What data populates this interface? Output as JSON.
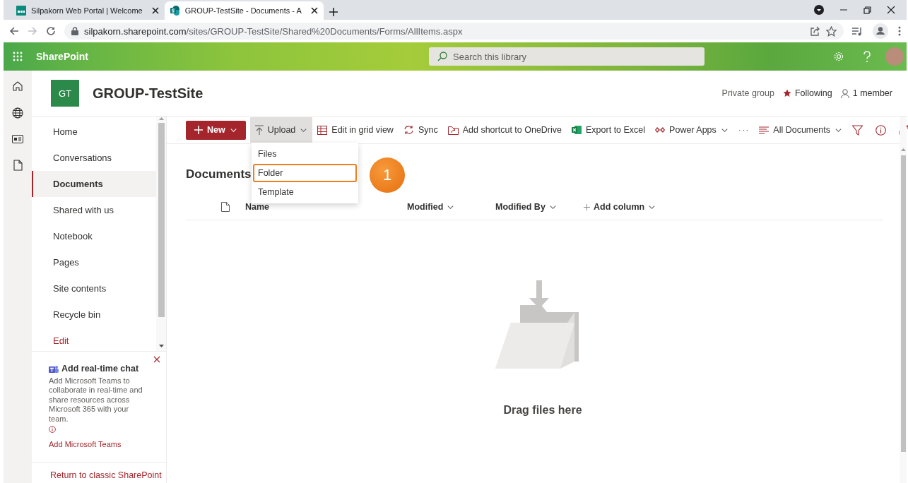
{
  "browser": {
    "tabs": [
      {
        "title": "Silpakorn Web Portal | Welcome",
        "selected": false
      },
      {
        "title": "GROUP-TestSite - Documents - A",
        "selected": true
      }
    ],
    "url_host": "silpakorn.sharepoint.com",
    "url_path": "/sites/GROUP-TestSite/Shared%20Documents/Forms/AllItems.aspx"
  },
  "suite_bar": {
    "app_name": "SharePoint",
    "search": {
      "placeholder": "Search this library"
    }
  },
  "site": {
    "logo": "GT",
    "title": "GROUP-TestSite",
    "privacy": "Private group",
    "following": "Following",
    "members": "1 member"
  },
  "nav": {
    "items": [
      {
        "label": "Home",
        "selected": false
      },
      {
        "label": "Conversations",
        "selected": false
      },
      {
        "label": "Documents",
        "selected": true
      },
      {
        "label": "Shared with us",
        "selected": false
      },
      {
        "label": "Notebook",
        "selected": false
      },
      {
        "label": "Pages",
        "selected": false
      },
      {
        "label": "Site contents",
        "selected": false
      },
      {
        "label": "Recycle bin",
        "selected": false
      }
    ],
    "edit": "Edit"
  },
  "teams_card": {
    "title": "Add real-time chat",
    "body": "Add Microsoft Teams to collaborate in real-time and share resources across Microsoft 365 with your team.",
    "link": "Add Microsoft Teams"
  },
  "return_link": "Return to classic SharePoint",
  "toolbar": {
    "commands": [
      {
        "kind": "primary",
        "label": "New",
        "expanded": false
      },
      {
        "kind": "upload",
        "label": "Upload",
        "expanded": true
      },
      {
        "kind": "grid",
        "label": "Edit in grid view",
        "expanded": false
      },
      {
        "kind": "sync",
        "label": "Sync",
        "expanded": false
      },
      {
        "kind": "shortcut",
        "label": "Add shortcut to OneDrive",
        "expanded": false
      },
      {
        "kind": "excel",
        "label": "Export to Excel",
        "expanded": false
      },
      {
        "kind": "powerapps",
        "label": "Power Apps",
        "expanded": false
      },
      {
        "kind": "more",
        "label": "···",
        "expanded": false
      }
    ],
    "view": "All Documents"
  },
  "upload_menu": {
    "items": [
      {
        "label": "Files",
        "highlighted": false
      },
      {
        "label": "Folder",
        "highlighted": true
      },
      {
        "label": "Template",
        "highlighted": false
      }
    ]
  },
  "callout": "1",
  "library": {
    "title": "Documents",
    "columns": [
      {
        "kind": "name",
        "label": "Name"
      },
      {
        "kind": "modified",
        "label": "Modified"
      },
      {
        "kind": "modified_by",
        "label": "Modified By"
      },
      {
        "kind": "add",
        "label": "Add column"
      }
    ],
    "empty_text": "Drag files here"
  }
}
